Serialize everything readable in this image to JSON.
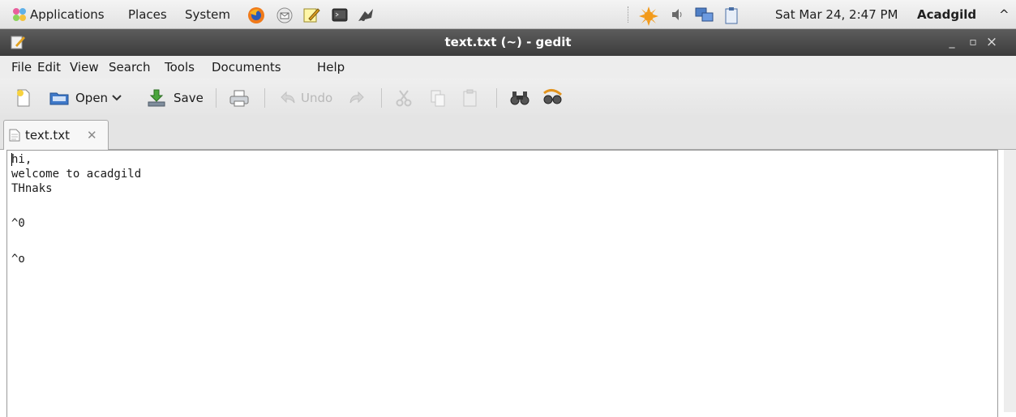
{
  "panel": {
    "menus": [
      "Applications",
      "Places",
      "System"
    ],
    "launchers": [
      "firefox-icon",
      "mail-icon",
      "text-editor-icon",
      "terminal-icon",
      "screenshot-icon"
    ],
    "tray": [
      "update-icon",
      "volume-icon",
      "network-icon",
      "clipboard-icon"
    ],
    "datetime": "Sat Mar 24,  2:47 PM",
    "user": "Acadgild",
    "user_arrow": "^"
  },
  "window": {
    "title": "text.txt (~) - gedit",
    "minimize": "_",
    "maximize": "▫",
    "close": "×"
  },
  "menubar": [
    "File",
    "Edit",
    "View",
    "Search",
    "Tools",
    "Documents",
    "Help"
  ],
  "toolbar": {
    "open_label": "Open",
    "save_label": "Save",
    "undo_label": "Undo"
  },
  "tab": {
    "label": "text.txt",
    "close": "✕"
  },
  "document": {
    "lines": [
      "hi,",
      "welcome to acadgild",
      "THnaks",
      "",
      "^0",
      "",
      "^o"
    ]
  },
  "colors": {
    "titlebar": "#4a4a4a",
    "panel": "#e8e8e8",
    "accent_blue": "#3a6fc4"
  }
}
